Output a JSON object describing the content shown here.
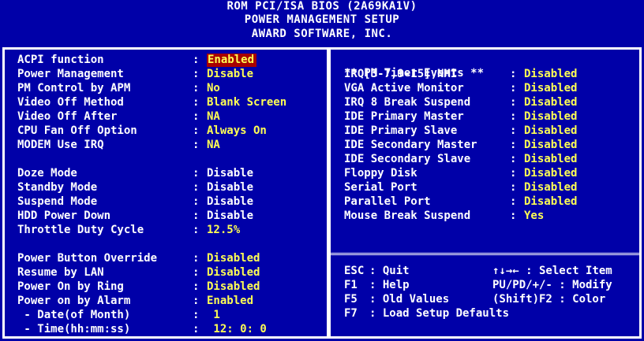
{
  "header": {
    "line1": "ROM PCI/ISA BIOS (2A69KA1V)",
    "line2": "POWER MANAGEMENT SETUP",
    "line3": "AWARD SOFTWARE, INC."
  },
  "left_groups": [
    [
      {
        "label": "ACPI function",
        "value": "Enabled",
        "style": "highlight"
      },
      {
        "label": "Power Management",
        "value": "Disable",
        "style": "yellow"
      },
      {
        "label": "PM Control by APM",
        "value": "No",
        "style": "yellow"
      },
      {
        "label": "Video Off Method",
        "value": "Blank Screen",
        "style": "yellow"
      },
      {
        "label": "Video Off After",
        "value": "NA",
        "style": "yellow"
      },
      {
        "label": "CPU Fan Off Option",
        "value": "Always On",
        "style": "yellow"
      },
      {
        "label": "MODEM Use IRQ",
        "value": "NA",
        "style": "yellow"
      }
    ],
    [
      {
        "label": "Doze Mode",
        "value": "Disable",
        "style": "white"
      },
      {
        "label": "Standby Mode",
        "value": "Disable",
        "style": "white"
      },
      {
        "label": "Suspend Mode",
        "value": "Disable",
        "style": "white"
      },
      {
        "label": "HDD Power Down",
        "value": "Disable",
        "style": "white"
      },
      {
        "label": "Throttle Duty Cycle",
        "value": "12.5%",
        "style": "yellow"
      }
    ],
    [
      {
        "label": "Power Button Override",
        "value": "Disabled",
        "style": "yellow",
        "tight": true
      },
      {
        "label": "Resume by LAN",
        "value": "Disabled",
        "style": "yellow"
      },
      {
        "label": "Power On by Ring",
        "value": "Disabled",
        "style": "yellow"
      },
      {
        "label": "Power on by Alarm",
        "value": "Enabled",
        "style": "yellow"
      },
      {
        "label": " - Date(of Month)",
        "value": " 1",
        "style": "yellow"
      },
      {
        "label": " - Time(hh:mm:ss)",
        "value": " 12: 0: 0",
        "style": "yellow"
      }
    ]
  ],
  "right": {
    "title": "** PM Timer Events **",
    "items": [
      {
        "label": "IRQ[3-7,9-15],NMI",
        "value": "Disabled"
      },
      {
        "label": "VGA Active Monitor",
        "value": "Disabled"
      },
      {
        "label": "IRQ 8 Break Suspend",
        "value": "Disabled"
      },
      {
        "label": "IDE Primary Master",
        "value": "Disabled"
      },
      {
        "label": "IDE Primary Slave",
        "value": "Disabled"
      },
      {
        "label": "IDE Secondary Master",
        "value": "Disabled"
      },
      {
        "label": "IDE Secondary Slave",
        "value": "Disabled"
      },
      {
        "label": "Floppy Disk",
        "value": "Disabled"
      },
      {
        "label": "Serial Port",
        "value": "Disabled"
      },
      {
        "label": "Parallel Port",
        "value": "Disabled"
      },
      {
        "label": "Mouse Break Suspend",
        "value": "Yes"
      }
    ]
  },
  "keys": [
    {
      "key": "ESC",
      "action": ": Quit",
      "hint": "↑↓→← : Select Item"
    },
    {
      "key": "F1",
      "action": ": Help",
      "hint": "PU/PD/+/- : Modify"
    },
    {
      "key": "F5",
      "action": ": Old Values",
      "hint": "(Shift)F2 : Color"
    },
    {
      "key": "F7",
      "action": ": Load Setup Defaults",
      "hint": ""
    }
  ],
  "colon": ":",
  "colors": {
    "background": "#0000a8",
    "value": "#ffff54",
    "highlight": "#a80000",
    "text": "#ffffff"
  }
}
